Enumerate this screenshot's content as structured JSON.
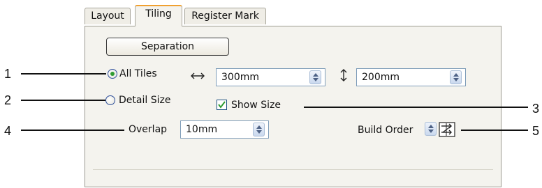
{
  "tabs": [
    {
      "label": "Layout"
    },
    {
      "label": "Tiling"
    },
    {
      "label": "Register Mark"
    }
  ],
  "separation_button": {
    "label": "Separation"
  },
  "tile_mode": {
    "options": [
      {
        "label": "All Tiles",
        "selected": true
      },
      {
        "label": "Detail Size",
        "selected": false
      }
    ]
  },
  "width": {
    "value": "300mm"
  },
  "height": {
    "value": "200mm"
  },
  "show_size": {
    "label": "Show Size",
    "checked": true
  },
  "overlap": {
    "label": "Overlap",
    "value": "10mm"
  },
  "build_order": {
    "label": "Build Order"
  },
  "callouts": [
    "1",
    "2",
    "3",
    "4",
    "5"
  ],
  "colors": {
    "accent_tab": "#f0a030",
    "radio_dot": "#2f9c31",
    "check": "#2f9c31"
  },
  "icons": [
    "horizontal-arrow-icon",
    "vertical-arrow-icon",
    "build-order-icon",
    "spin-up-icon",
    "spin-down-icon"
  ]
}
